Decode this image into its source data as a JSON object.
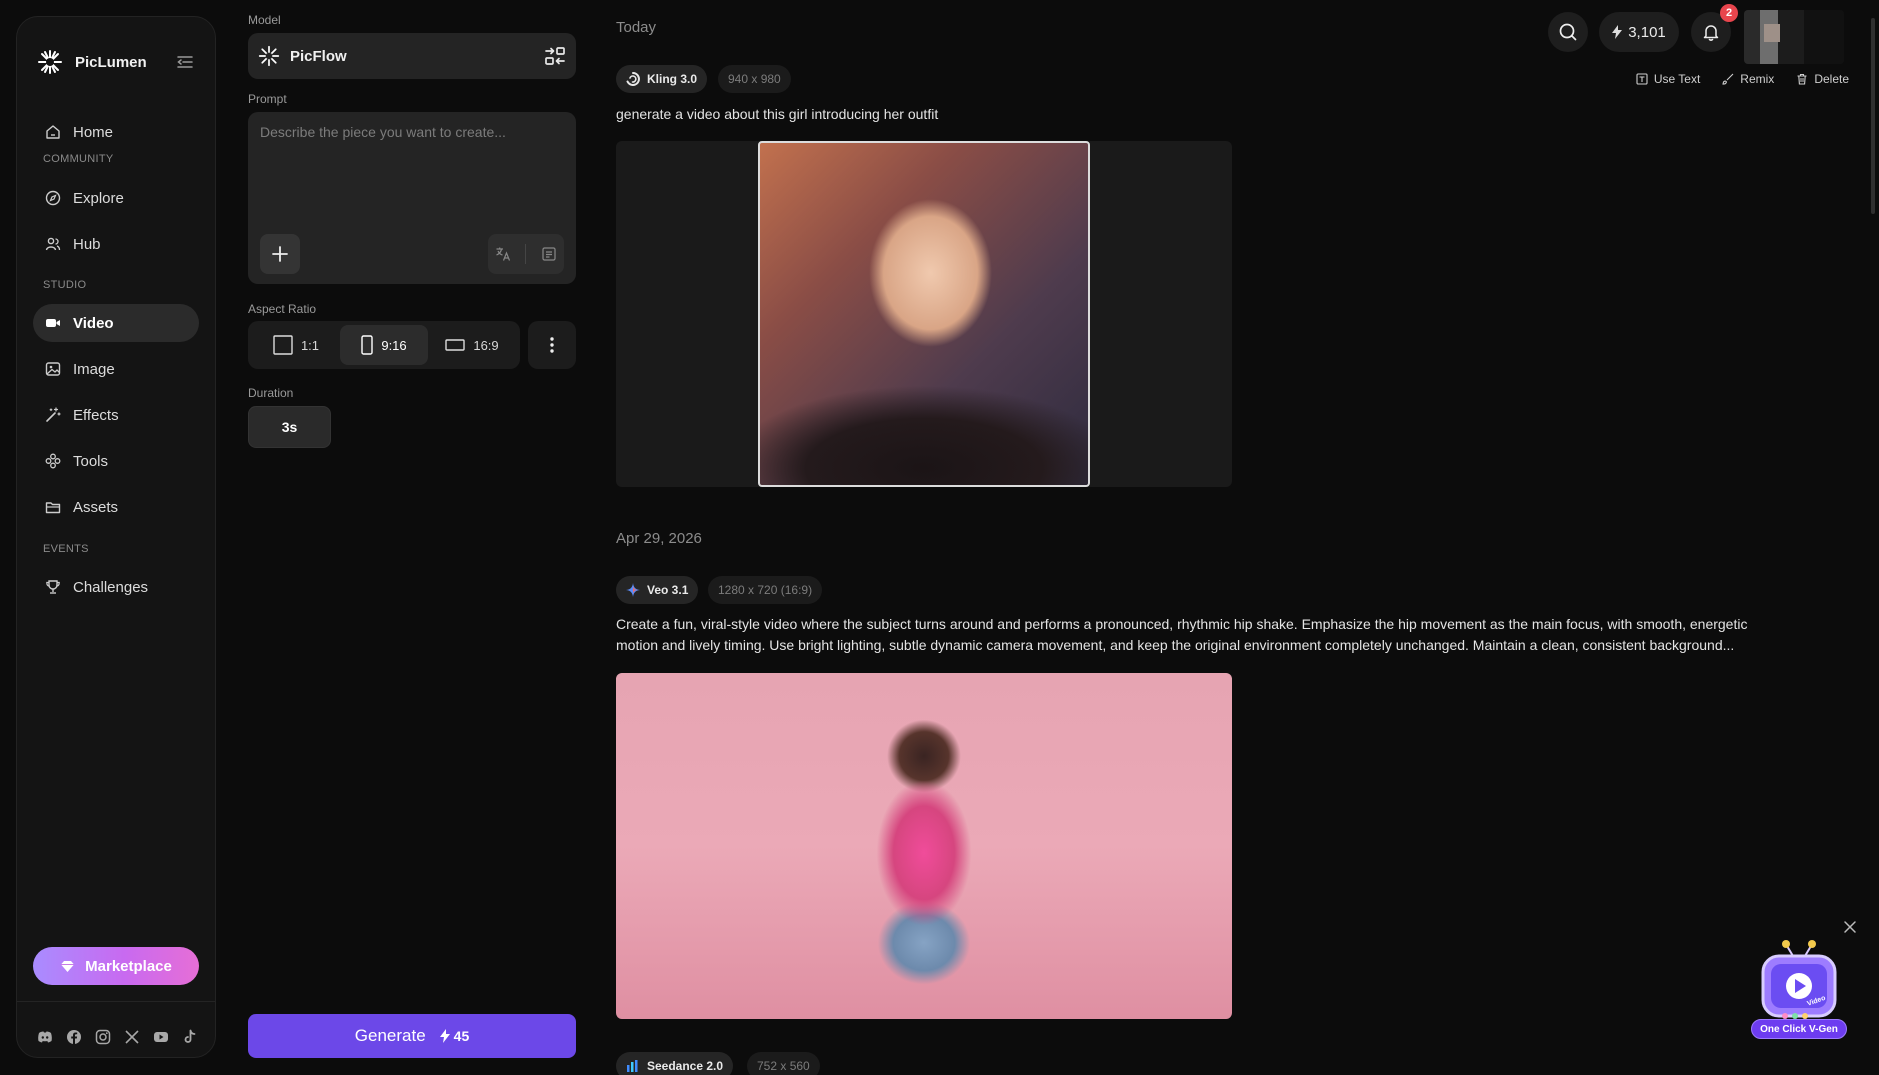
{
  "brand": {
    "name": "PicLumen"
  },
  "sidebar": {
    "home": "Home",
    "community_label": "COMMUNITY",
    "explore": "Explore",
    "hub": "Hub",
    "studio_label": "STUDIO",
    "video": "Video",
    "image": "Image",
    "effects": "Effects",
    "tools": "Tools",
    "assets": "Assets",
    "events_label": "EVENTS",
    "challenges": "Challenges",
    "marketplace": "Marketplace"
  },
  "panel": {
    "model_label": "Model",
    "model_name": "PicFlow",
    "prompt_label": "Prompt",
    "prompt_placeholder": "Describe the piece you want to create...",
    "aspect_label": "Aspect Ratio",
    "aspect_options": [
      "1:1",
      "9:16",
      "16:9"
    ],
    "aspect_selected": "9:16",
    "duration_label": "Duration",
    "duration_value": "3s",
    "generate_label": "Generate",
    "generate_cost": "45"
  },
  "topbar": {
    "credits": "3,101",
    "notifications": "2"
  },
  "actions": {
    "use_text": "Use Text",
    "remix": "Remix",
    "delete": "Delete"
  },
  "feed": {
    "today": "Today",
    "item1": {
      "model": "Kling 3.0",
      "size": "940 x 980",
      "prompt": "generate a video about this girl introducing her outfit"
    },
    "date2": "Apr 29, 2026",
    "item2": {
      "model": "Veo 3.1",
      "size": "1280 x 720 (16:9)",
      "prompt_line1": "Create a fun, viral-style video where the subject turns around and performs a pronounced, rhythmic hip shake. Emphasize the hip movement as the main focus, with smooth, energetic",
      "prompt_line2": "motion and lively timing. Use bright lighting, subtle dynamic camera movement, and keep the original environment completely unchanged. Maintain a clean, consistent background..."
    },
    "item3": {
      "model": "Seedance 2.0",
      "size": "752 x 560"
    }
  },
  "promo": {
    "label": "One Click V-Gen",
    "tv_text": "Video"
  },
  "colors": {
    "accent": "#6c48e8",
    "badge": "#e8454d"
  }
}
